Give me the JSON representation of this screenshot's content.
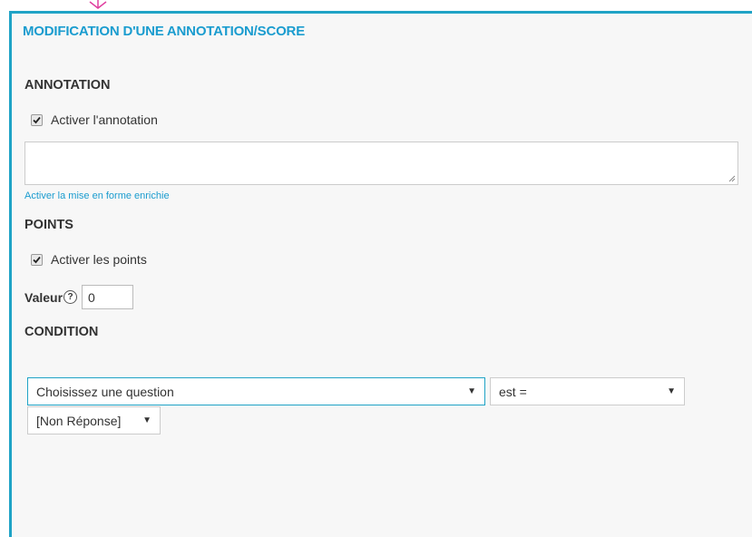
{
  "panel": {
    "title": "MODIFICATION D'UNE ANNOTATION/SCORE",
    "accent_color": "#1fa3c6"
  },
  "annotation": {
    "heading": "ANNOTATION",
    "checkbox_label": "Activer l'annotation",
    "checked": true,
    "text_value": "",
    "rich_text_link": "Activer la mise en forme enrichie"
  },
  "points": {
    "heading": "POINTS",
    "checkbox_label": "Activer les points",
    "checked": true,
    "value_label": "Valeur",
    "help_icon": "?",
    "value": "0"
  },
  "condition": {
    "heading": "CONDITION",
    "question_select": "Choisissez une question",
    "operator_select": "est =",
    "answer_select": "[Non Réponse]",
    "caret_icon": "▼"
  }
}
